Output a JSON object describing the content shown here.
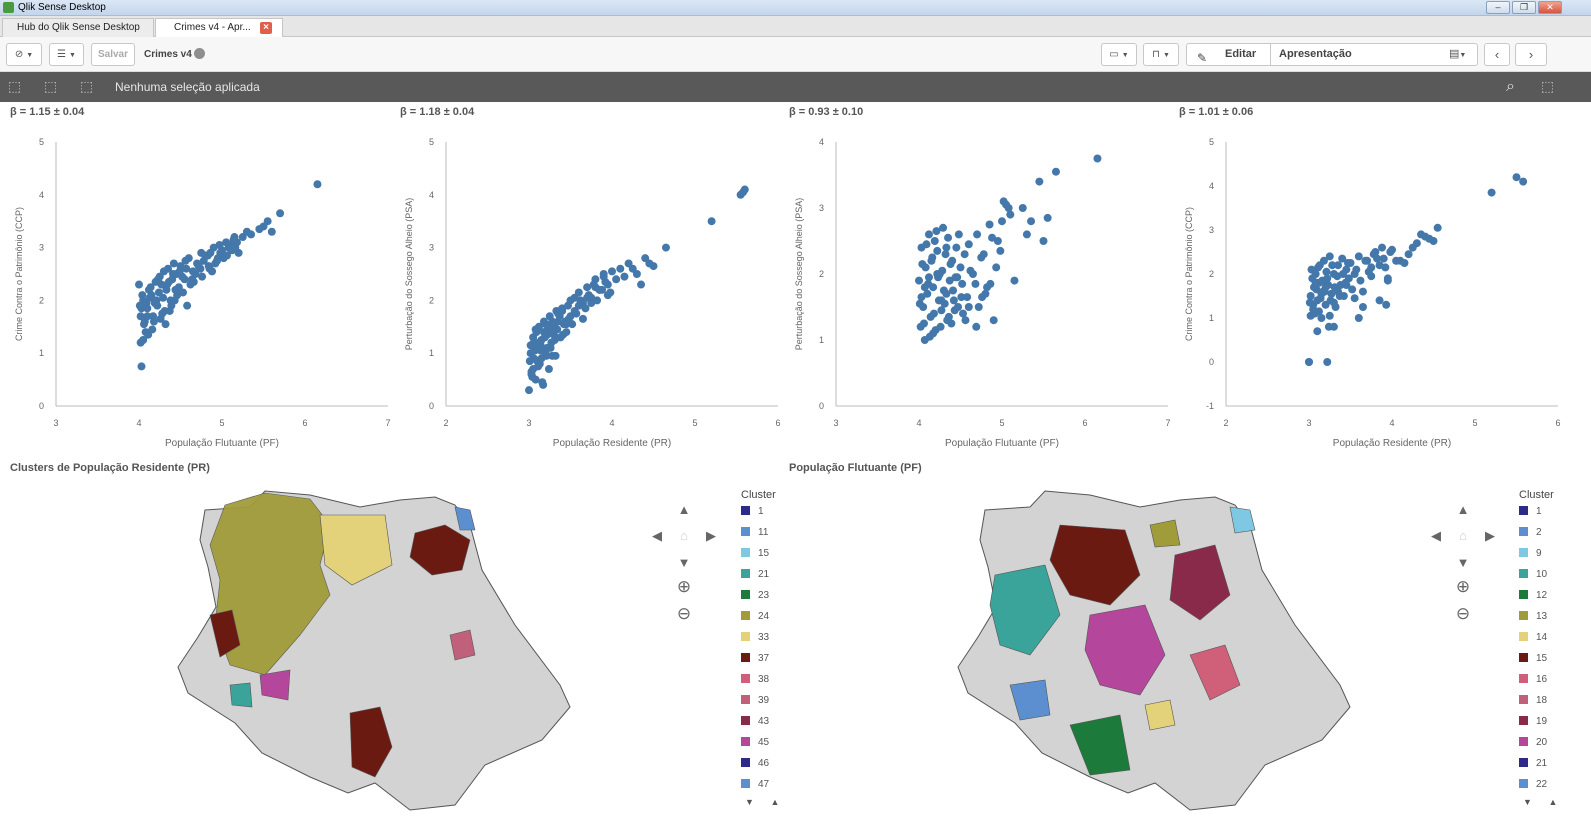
{
  "window": {
    "title": "Qlik Sense Desktop",
    "controls": [
      "–",
      "❐",
      "✕"
    ]
  },
  "tabs": [
    {
      "label": "Hub do Qlik Sense Desktop",
      "active": false
    },
    {
      "label": "Crimes v4 - Apr...",
      "active": true
    }
  ],
  "toolbar": {
    "save_label": "Salvar",
    "app_title": "Crimes v4",
    "edit_label": "Editar",
    "sheet_name": "Apresentação"
  },
  "selection_bar": {
    "message": "Nenhuma seleção aplicada"
  },
  "scatter_charts": [
    {
      "label": "β = 1.15 ± 0.04"
    },
    {
      "label": "β = 1.18 ± 0.04"
    },
    {
      "label": "β = 0.93 ± 0.10"
    },
    {
      "label": "β = 1.01 ± 0.06"
    }
  ],
  "chart_data": [
    {
      "type": "scatter",
      "title": "β = 1.15 ± 0.04",
      "xlabel": "População Flutuante (PF)",
      "ylabel": "Crime Contra o Patrimônio (CCP)",
      "xlim": [
        3,
        7
      ],
      "ylim": [
        0,
        5
      ],
      "xticks": [
        3,
        4,
        5,
        6,
        7
      ],
      "yticks": [
        0,
        1,
        2,
        3,
        4,
        5
      ],
      "color": "#4477aa",
      "x": [
        4.0,
        4.02,
        4.03,
        4.05,
        4.08,
        4.1,
        4.12,
        4.15,
        4.18,
        4.2,
        4.22,
        4.25,
        4.28,
        4.3,
        4.33,
        4.35,
        4.38,
        4.4,
        4.42,
        4.45,
        4.48,
        4.5,
        4.55,
        4.6,
        4.65,
        4.7,
        4.75,
        4.8,
        4.85,
        4.9,
        4.95,
        5.0,
        5.05,
        5.1,
        5.15,
        5.2,
        5.3,
        5.35,
        5.45,
        5.5,
        5.55,
        5.6,
        5.7,
        6.15,
        4.02,
        4.04,
        4.06,
        4.09,
        4.11,
        4.14,
        4.17,
        4.21,
        4.24,
        4.27,
        4.31,
        4.36,
        4.41,
        4.46,
        4.52,
        4.57,
        4.62,
        4.68,
        4.72,
        4.78,
        4.83,
        4.88,
        4.92,
        4.98,
        5.02,
        5.08,
        5.12,
        5.18,
        4.03,
        4.07,
        4.13,
        4.19,
        4.23,
        4.29,
        4.34,
        4.39,
        4.44,
        4.49,
        4.56,
        4.64,
        4.74,
        4.86,
        4.97,
        5.06,
        5.14,
        5.25,
        4.01,
        4.05,
        4.1,
        4.16,
        4.26,
        4.32,
        4.37,
        4.43,
        4.53,
        4.58,
        4.66,
        4.76,
        4.84,
        4.94,
        5.03,
        5.16
      ],
      "y": [
        2.3,
        1.7,
        0.75,
        2.0,
        1.4,
        1.85,
        2.2,
        2.1,
        1.6,
        2.35,
        1.9,
        2.45,
        1.75,
        2.55,
        2.2,
        2.6,
        2.0,
        2.4,
        2.7,
        2.5,
        2.25,
        2.65,
        2.4,
        2.8,
        2.55,
        2.7,
        2.9,
        2.85,
        2.6,
        3.0,
        2.8,
        2.95,
        3.1,
        3.05,
        3.2,
        2.9,
        3.3,
        3.25,
        3.35,
        3.4,
        3.5,
        3.3,
        3.65,
        4.2,
        1.2,
        2.1,
        1.55,
        1.95,
        1.35,
        2.25,
        1.7,
        2.0,
        2.15,
        2.3,
        1.8,
        2.35,
        2.5,
        2.1,
        2.45,
        2.6,
        2.3,
        2.5,
        2.65,
        2.75,
        2.85,
        2.55,
        2.7,
        2.9,
        2.8,
        3.0,
        2.95,
        3.1,
        1.85,
        1.6,
        2.05,
        1.95,
        2.4,
        2.05,
        2.3,
        1.9,
        2.2,
        2.55,
        2.75,
        2.4,
        2.6,
        2.9,
        3.05,
        2.85,
        3.15,
        3.2,
        1.9,
        1.25,
        1.7,
        1.45,
        1.65,
        1.55,
        1.8,
        2.0,
        2.15,
        1.9,
        2.35,
        2.45,
        2.65,
        2.75,
        2.85,
        3.0
      ]
    },
    {
      "type": "scatter",
      "title": "β = 1.18 ± 0.04",
      "xlabel": "População Residente (PR)",
      "ylabel": "Perturbação do Sossego Alheio (PSA)",
      "xlim": [
        2,
        6
      ],
      "ylim": [
        0,
        5
      ],
      "xticks": [
        2,
        3,
        4,
        5,
        6
      ],
      "yticks": [
        0,
        1,
        2,
        3,
        4,
        5
      ],
      "color": "#4477aa",
      "x": [
        3.0,
        3.02,
        3.03,
        3.05,
        3.06,
        3.08,
        3.1,
        3.12,
        3.13,
        3.15,
        3.17,
        3.18,
        3.2,
        3.22,
        3.24,
        3.25,
        3.27,
        3.3,
        3.32,
        3.35,
        3.38,
        3.4,
        3.42,
        3.45,
        3.48,
        3.5,
        3.55,
        3.6,
        3.65,
        3.7,
        3.75,
        3.8,
        3.85,
        3.9,
        3.95,
        4.0,
        4.1,
        4.2,
        4.3,
        4.4,
        4.5,
        4.65,
        5.2,
        5.55,
        5.58,
        5.6,
        3.01,
        3.04,
        3.07,
        3.09,
        3.11,
        3.14,
        3.16,
        3.19,
        3.21,
        3.23,
        3.26,
        3.28,
        3.31,
        3.34,
        3.37,
        3.41,
        3.44,
        3.47,
        3.52,
        3.57,
        3.62,
        3.68,
        3.72,
        3.78,
        3.82,
        3.88,
        3.92,
        3.98,
        4.05,
        3.02,
        3.05,
        3.08,
        3.12,
        3.15,
        3.2,
        3.25,
        3.3,
        3.35,
        3.4,
        3.5,
        3.6,
        3.7,
        3.8,
        3.9,
        4.15,
        4.25,
        4.35,
        3.03,
        3.06,
        3.1,
        3.14,
        3.18,
        3.22,
        3.28,
        3.33,
        3.45,
        3.55,
        3.65,
        3.75,
        3.85,
        3.95,
        4.45
      ],
      "y": [
        0.3,
        1.0,
        0.6,
        1.3,
        0.9,
        0.5,
        1.1,
        1.5,
        0.8,
        1.25,
        0.4,
        1.6,
        1.0,
        1.35,
        0.7,
        1.7,
        1.2,
        1.5,
        0.95,
        1.75,
        1.3,
        1.85,
        1.55,
        1.4,
        1.65,
        2.0,
        1.8,
        2.15,
        1.95,
        2.25,
        2.05,
        2.4,
        2.2,
        2.45,
        2.3,
        2.55,
        2.6,
        2.7,
        2.5,
        2.8,
        2.65,
        3.0,
        3.5,
        4.0,
        4.05,
        4.1,
        0.85,
        0.55,
        1.05,
        1.4,
        0.75,
        1.15,
        0.45,
        1.3,
        0.95,
        1.5,
        1.1,
        1.6,
        1.25,
        1.45,
        1.7,
        1.35,
        1.6,
        1.9,
        1.55,
        1.75,
        2.0,
        1.85,
        2.1,
        2.3,
        2.0,
        2.2,
        2.35,
        2.15,
        2.4,
        1.15,
        0.7,
        1.45,
        1.2,
        0.9,
        1.55,
        1.45,
        1.35,
        1.6,
        1.8,
        1.7,
        1.9,
        2.05,
        2.25,
        2.5,
        2.45,
        2.6,
        2.3,
        0.65,
        1.2,
        0.85,
        1.05,
        1.4,
        1.1,
        0.95,
        1.8,
        1.55,
        2.05,
        1.65,
        1.95,
        2.2,
        2.1,
        2.7
      ]
    },
    {
      "type": "scatter",
      "title": "β = 0.93 ± 0.10",
      "xlabel": "População Flutuante (PF)",
      "ylabel": "Perturbação do Sossego Alheio (PSA)",
      "xlim": [
        3,
        7
      ],
      "ylim": [
        0,
        4
      ],
      "xticks": [
        3,
        4,
        5,
        6,
        7
      ],
      "yticks": [
        0,
        1,
        2,
        3,
        4
      ],
      "color": "#4477aa",
      "x": [
        4.0,
        4.02,
        4.03,
        4.05,
        4.07,
        4.08,
        4.1,
        4.12,
        4.14,
        4.15,
        4.17,
        4.19,
        4.2,
        4.22,
        4.24,
        4.25,
        4.27,
        4.29,
        4.3,
        4.32,
        4.34,
        4.35,
        4.37,
        4.4,
        4.42,
        4.45,
        4.47,
        4.5,
        4.52,
        4.55,
        4.58,
        4.6,
        4.65,
        4.7,
        4.75,
        4.8,
        4.85,
        4.9,
        4.95,
        5.0,
        5.05,
        5.1,
        5.15,
        5.25,
        5.3,
        5.35,
        5.45,
        5.5,
        5.55,
        5.65,
        6.15,
        4.01,
        4.04,
        4.06,
        4.09,
        4.11,
        4.13,
        4.16,
        4.18,
        4.21,
        4.23,
        4.26,
        4.28,
        4.31,
        4.33,
        4.36,
        4.38,
        4.41,
        4.43,
        4.46,
        4.48,
        4.51,
        4.56,
        4.62,
        4.68,
        4.72,
        4.78,
        4.82,
        4.88,
        4.93,
        4.98,
        5.02,
        5.08,
        4.03,
        4.07,
        4.12,
        4.17,
        4.22,
        4.27,
        4.33,
        4.39,
        4.44,
        4.53,
        4.6,
        4.69,
        4.76,
        4.86
      ],
      "y": [
        1.9,
        1.2,
        2.4,
        1.5,
        1.0,
        2.1,
        1.7,
        2.6,
        1.35,
        2.2,
        1.8,
        2.5,
        1.15,
        2.35,
        1.6,
        2.0,
        1.45,
        2.7,
        1.75,
        2.3,
        1.3,
        2.55,
        1.9,
        2.2,
        1.6,
        2.4,
        1.5,
        2.1,
        1.85,
        2.3,
        1.65,
        2.45,
        2.0,
        2.6,
        2.25,
        1.7,
        2.75,
        1.3,
        2.5,
        2.8,
        3.05,
        2.9,
        1.9,
        3.0,
        2.6,
        2.8,
        3.4,
        2.5,
        2.85,
        3.55,
        3.75,
        1.55,
        2.15,
        1.25,
        2.45,
        1.85,
        1.05,
        2.25,
        1.4,
        2.65,
        1.95,
        1.2,
        2.05,
        1.55,
        2.4,
        1.35,
        2.15,
        1.75,
        1.45,
        1.95,
        2.6,
        1.65,
        1.3,
        2.05,
        1.85,
        1.5,
        2.3,
        1.8,
        2.55,
        2.1,
        2.35,
        3.1,
        3.0,
        1.65,
        1.8,
        1.95,
        1.1,
        2.0,
        1.6,
        1.7,
        1.25,
        1.95,
        1.4,
        1.5,
        1.2,
        1.65,
        1.85
      ]
    },
    {
      "type": "scatter",
      "title": "β = 1.01 ± 0.06",
      "xlabel": "População Residente (PR)",
      "ylabel": "Crime Contra o Patrimônio (CCP)",
      "xlim": [
        2,
        6
      ],
      "ylim": [
        -1,
        5
      ],
      "xticks": [
        2,
        3,
        4,
        5,
        6
      ],
      "yticks": [
        -1,
        0,
        1,
        2,
        3,
        4,
        5
      ],
      "color": "#4477aa",
      "x": [
        3.0,
        3.02,
        3.03,
        3.05,
        3.06,
        3.08,
        3.1,
        3.12,
        3.13,
        3.15,
        3.17,
        3.18,
        3.2,
        3.22,
        3.24,
        3.25,
        3.27,
        3.3,
        3.32,
        3.35,
        3.38,
        3.4,
        3.42,
        3.45,
        3.48,
        3.5,
        3.55,
        3.6,
        3.65,
        3.7,
        3.75,
        3.8,
        3.85,
        3.9,
        3.95,
        4.0,
        4.1,
        4.2,
        4.3,
        4.4,
        4.5,
        4.55,
        5.2,
        5.5,
        5.58,
        3.01,
        3.04,
        3.07,
        3.09,
        3.11,
        3.14,
        3.16,
        3.19,
        3.21,
        3.23,
        3.26,
        3.28,
        3.31,
        3.34,
        3.37,
        3.41,
        3.44,
        3.47,
        3.52,
        3.57,
        3.62,
        3.68,
        3.72,
        3.78,
        3.82,
        3.88,
        3.92,
        3.98,
        4.05,
        4.15,
        3.02,
        3.05,
        3.08,
        3.12,
        3.15,
        3.2,
        3.25,
        3.3,
        3.35,
        3.45,
        3.55,
        3.65,
        3.75,
        3.85,
        3.95,
        4.25,
        4.35,
        4.45,
        3.0,
        3.22,
        3.1,
        3.6,
        3.3,
        3.93
      ],
      "y": [
        0.0,
        1.5,
        2.1,
        1.2,
        1.7,
        2.0,
        1.4,
        1.8,
        2.2,
        1.0,
        1.6,
        2.3,
        1.3,
        1.9,
        0.8,
        2.4,
        1.55,
        2.0,
        1.25,
        2.2,
        1.75,
        2.35,
        1.5,
        2.1,
        1.9,
        2.25,
        2.0,
        2.4,
        1.6,
        2.3,
        2.15,
        2.5,
        2.2,
        2.35,
        1.9,
        2.55,
        2.3,
        2.45,
        2.7,
        2.85,
        2.75,
        3.05,
        3.85,
        4.2,
        4.1,
        1.35,
        1.9,
        1.1,
        1.65,
        2.15,
        1.45,
        1.85,
        1.6,
        2.05,
        1.75,
        1.4,
        2.2,
        1.7,
        1.95,
        1.5,
        2.0,
        1.8,
        2.25,
        1.65,
        2.1,
        1.85,
        2.3,
        2.05,
        2.45,
        2.35,
        2.6,
        2.15,
        2.5,
        2.3,
        2.25,
        1.05,
        1.3,
        1.8,
        1.15,
        1.55,
        1.7,
        1.05,
        1.35,
        1.6,
        1.75,
        1.45,
        1.25,
        1.95,
        1.4,
        1.85,
        2.6,
        2.9,
        2.8,
        0.0,
        0.0,
        0.7,
        1.0,
        0.8,
        1.3
      ]
    }
  ],
  "maps": [
    {
      "title": "Clusters de População Residente (PR)",
      "legend_title": "Cluster",
      "legend": [
        {
          "label": "1",
          "color": "#2b2b8a"
        },
        {
          "label": "11",
          "color": "#5b8fd0"
        },
        {
          "label": "15",
          "color": "#7ec8e3"
        },
        {
          "label": "21",
          "color": "#3aa39a"
        },
        {
          "label": "23",
          "color": "#1c7a3a"
        },
        {
          "label": "24",
          "color": "#a19c3a"
        },
        {
          "label": "33",
          "color": "#e3d27a"
        },
        {
          "label": "37",
          "color": "#6b1a12"
        },
        {
          "label": "38",
          "color": "#d0607a"
        },
        {
          "label": "39",
          "color": "#c0607a"
        },
        {
          "label": "43",
          "color": "#8a2a4a"
        },
        {
          "label": "45",
          "color": "#b4479b"
        },
        {
          "label": "46",
          "color": "#2e2a8a"
        },
        {
          "label": "47",
          "color": "#5b8fd0"
        }
      ]
    },
    {
      "title": "População Flutuante (PF)",
      "legend_title": "Cluster",
      "legend": [
        {
          "label": "1",
          "color": "#2b2b8a"
        },
        {
          "label": "2",
          "color": "#5b8fd0"
        },
        {
          "label": "9",
          "color": "#7ec8e3"
        },
        {
          "label": "10",
          "color": "#3aa39a"
        },
        {
          "label": "12",
          "color": "#1c7a3a"
        },
        {
          "label": "13",
          "color": "#a19c3a"
        },
        {
          "label": "14",
          "color": "#e3d27a"
        },
        {
          "label": "15",
          "color": "#6b1a12"
        },
        {
          "label": "16",
          "color": "#d0607a"
        },
        {
          "label": "18",
          "color": "#c0607a"
        },
        {
          "label": "19",
          "color": "#8a2a4a"
        },
        {
          "label": "20",
          "color": "#b4479b"
        },
        {
          "label": "21",
          "color": "#2e2a8a"
        },
        {
          "label": "22",
          "color": "#5b8fd0"
        }
      ]
    }
  ],
  "icons": {
    "nav": "compass-icon",
    "list": "list-icon",
    "present": "present-icon",
    "bookmark": "bookmark-icon",
    "search": "search-icon"
  }
}
